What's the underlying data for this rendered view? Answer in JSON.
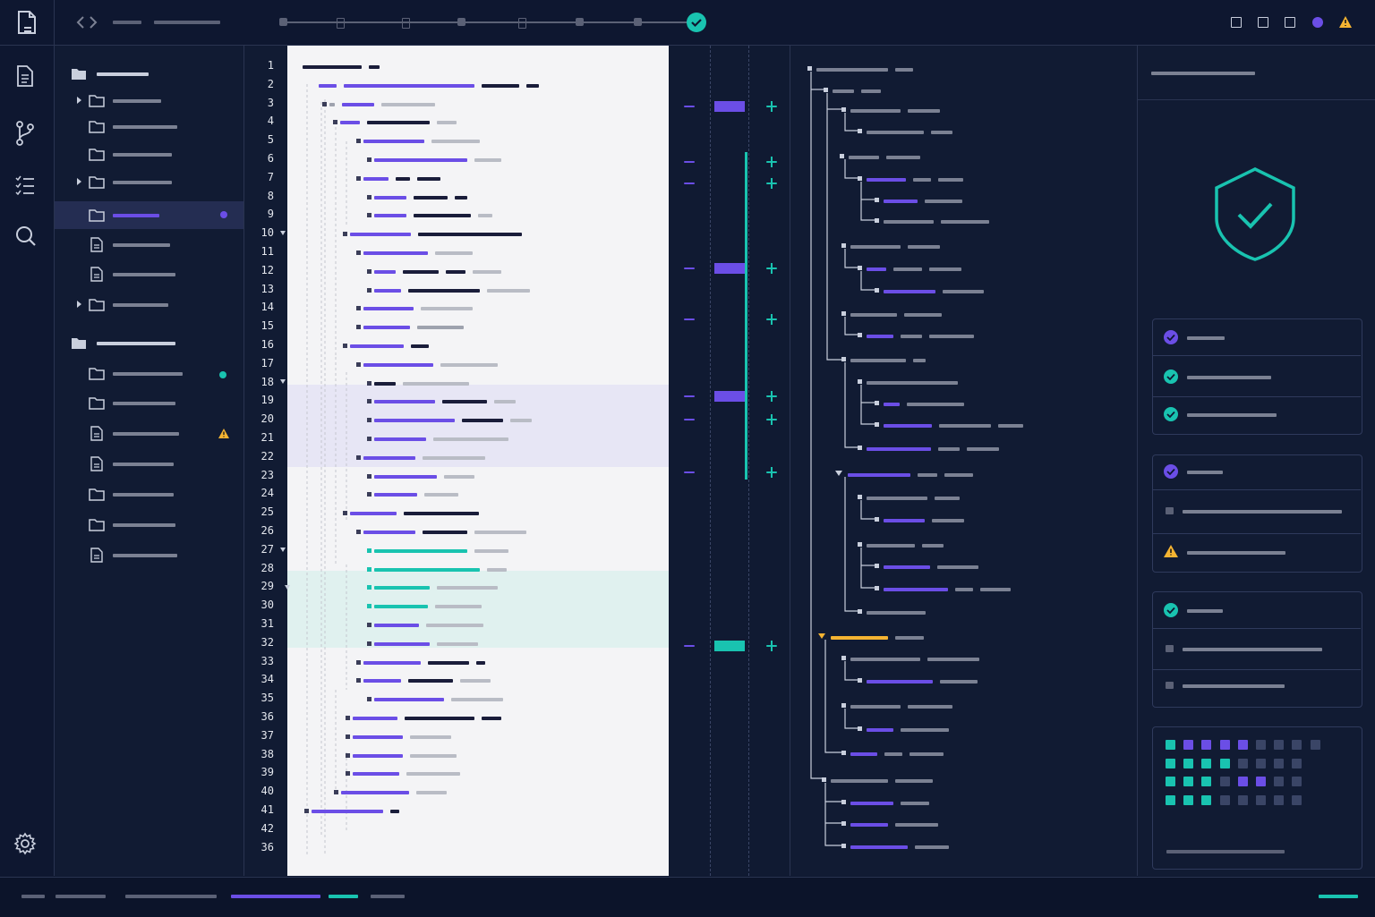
{
  "colors": {
    "bg": "#0f1830",
    "panel": "#101a32",
    "panel_dark": "#0c142a",
    "accent": "#6b4ee6",
    "teal": "#19c3b0",
    "warning": "#f5b432",
    "editor_bg": "#f4f4f6"
  },
  "topbar": {
    "icons": [
      "document-icon",
      "code-brackets-icon"
    ],
    "pipeline_steps": 8,
    "pipeline_complete": true,
    "window_controls": [
      "square-icon",
      "square-icon",
      "square-icon",
      "status-dot",
      "warning-icon"
    ]
  },
  "activity_bar": [
    "file-icon",
    "branch-icon",
    "list-icon",
    "search-icon",
    "settings-icon"
  ],
  "explorer": {
    "groups": [
      {
        "type": "folder-open"
      },
      {
        "type": "folder-open"
      }
    ],
    "selected_item_status": "modified",
    "status_badges": [
      "dot-accent",
      "dot-teal",
      "warning"
    ]
  },
  "editor": {
    "line_numbers": [
      "1",
      "2",
      "3",
      "4",
      "5",
      "6",
      "7",
      "8",
      "9",
      "10",
      "11",
      "12",
      "13",
      "14",
      "15",
      "16",
      "17",
      "18",
      "19",
      "20",
      "21",
      "22",
      "23",
      "24",
      "25",
      "26",
      "27",
      "28",
      "29",
      "30",
      "31",
      "32",
      "33",
      "34",
      "35",
      "36",
      "37",
      "38",
      "39",
      "40",
      "41",
      "42",
      "36"
    ]
  },
  "diff_gutter": {
    "markers": [
      "minus-icon",
      "plus-icon"
    ]
  },
  "security_panel": {
    "status_icon": "shield-check-icon",
    "checks": [
      "check-icon",
      "check-icon",
      "check-icon",
      "check-icon",
      "warning-icon",
      "check-icon"
    ]
  },
  "statusbar": {}
}
